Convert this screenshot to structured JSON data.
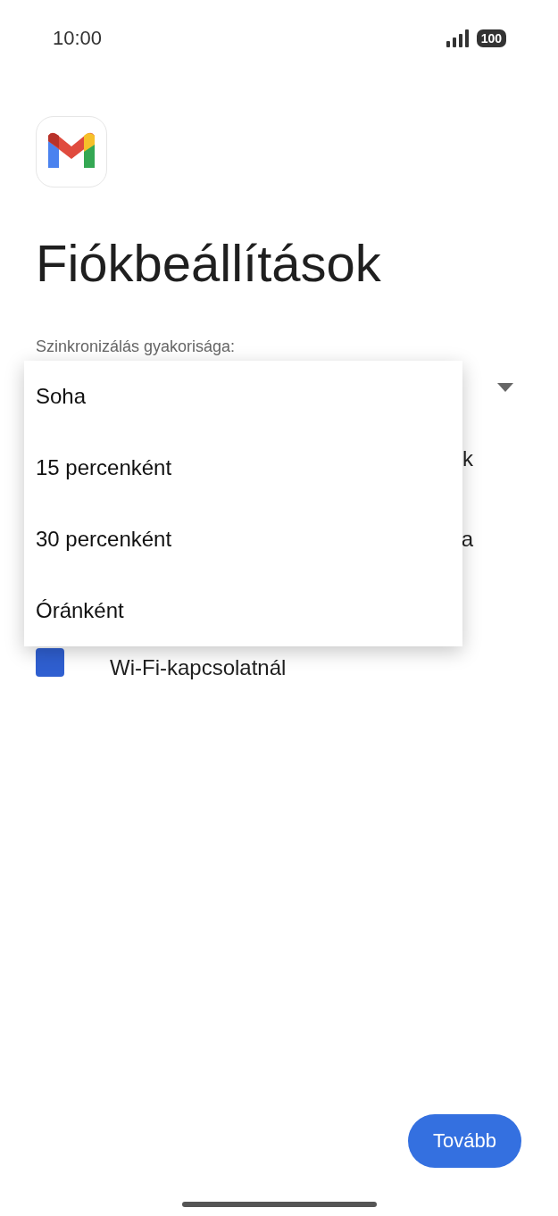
{
  "status_bar": {
    "time": "10:00",
    "battery": "100"
  },
  "title": "Fiókbeállítások",
  "sync": {
    "label": "Szinkronizálás gyakorisága:",
    "options": [
      "Soha",
      "15 percenként",
      "30 percenként",
      "Óránként"
    ]
  },
  "hidden_rows": [
    {
      "text": "k"
    },
    {
      "text": "a"
    }
  ],
  "wifi_option": {
    "label": "Wi-Fi-kapcsolatnál",
    "checked": true
  },
  "next_button": "Tovább"
}
